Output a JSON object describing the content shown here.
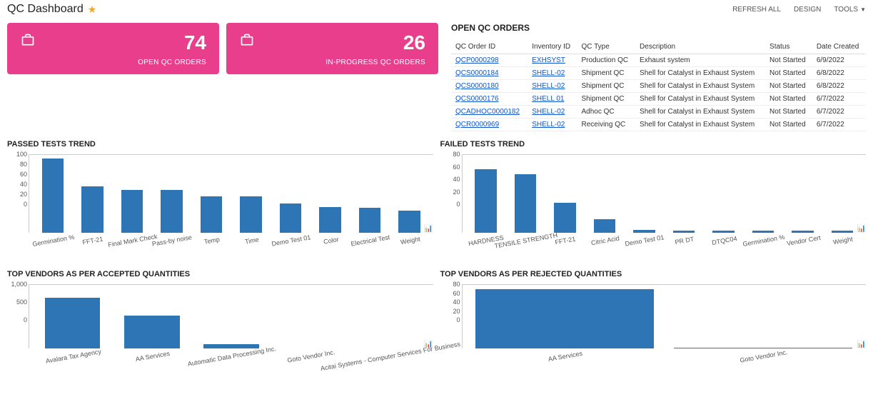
{
  "header": {
    "title": "QC Dashboard",
    "refresh_label": "REFRESH ALL",
    "design_label": "DESIGN",
    "tools_label": "TOOLS"
  },
  "kpis": [
    {
      "value": "74",
      "label": "OPEN QC ORDERS"
    },
    {
      "value": "26",
      "label": "IN-PROGRESS QC ORDERS"
    }
  ],
  "orders": {
    "title": "OPEN QC ORDERS",
    "columns": [
      "QC Order ID",
      "Inventory ID",
      "QC Type",
      "Description",
      "Status",
      "Date Created"
    ],
    "rows": [
      {
        "id": "QCP0000298",
        "inv": "EXHSYST",
        "type": "Production QC",
        "desc": "Exhaust system",
        "status": "Not Started",
        "date": "6/9/2022"
      },
      {
        "id": "QCS0000184",
        "inv": "SHELL-02",
        "type": "Shipment QC",
        "desc": "Shell for Catalyst in Exhaust System",
        "status": "Not Started",
        "date": "6/8/2022"
      },
      {
        "id": "QCS0000180",
        "inv": "SHELL-02",
        "type": "Shipment QC",
        "desc": "Shell for Catalyst in Exhaust System",
        "status": "Not Started",
        "date": "6/8/2022"
      },
      {
        "id": "QCS0000176",
        "inv": "SHELL 01",
        "type": "Shipment QC",
        "desc": "Shell for Catalyst in Exhaust System",
        "status": "Not Started",
        "date": "6/7/2022"
      },
      {
        "id": "QCADHOC0000182",
        "inv": "SHELL-02",
        "type": "Adhoc QC",
        "desc": "Shell for Catalyst in Exhaust System",
        "status": "Not Started",
        "date": "6/7/2022"
      },
      {
        "id": "QCR0000969",
        "inv": "SHELL-02",
        "type": "Receiving QC",
        "desc": "Shell for Catalyst in Exhaust System",
        "status": "Not Started",
        "date": "6/7/2022"
      }
    ]
  },
  "chart_data": [
    {
      "id": "passed",
      "type": "bar",
      "title": "PASSED TESTS TREND",
      "ylim": [
        0,
        100
      ],
      "yticks": [
        0,
        20,
        40,
        60,
        80,
        100
      ],
      "categories": [
        "Germination %",
        "FFT-21",
        "Final Mark Check",
        "Pass-by noise",
        "Temp",
        "Time",
        "Demo Test 01",
        "Color",
        "Electrical Test",
        "Weight"
      ],
      "values": [
        95,
        60,
        55,
        55,
        47,
        47,
        38,
        33,
        32,
        28
      ]
    },
    {
      "id": "failed",
      "type": "bar",
      "title": "FAILED TESTS TREND",
      "ylim": [
        0,
        80
      ],
      "yticks": [
        0,
        20,
        40,
        60,
        80
      ],
      "categories": [
        "HARDNESS",
        "TENSILE STRENGTH",
        "FFT-21",
        "Citric Acid",
        "Demo Test 01",
        "PR DT",
        "DTQC04",
        "Germination %",
        "Vendor Cert",
        "Weight"
      ],
      "values": [
        65,
        60,
        31,
        14,
        3,
        2,
        2,
        2,
        2,
        2
      ]
    },
    {
      "id": "accepted-vendors",
      "type": "bar",
      "title": "TOP VENDORS AS PER ACCEPTED QUANTITIES",
      "ylim": [
        0,
        1000
      ],
      "yticks": [
        0,
        500,
        1000
      ],
      "categories": [
        "Avalara Tax Agency",
        "AA Services",
        "Automatic Data Processing Inc.",
        "Goto Vendor Inc.",
        "Acitai Systems - Computer Services For Business"
      ],
      "values": [
        800,
        520,
        70,
        0,
        0
      ]
    },
    {
      "id": "rejected-vendors",
      "type": "bar",
      "title": "TOP VENDORS AS PER REJECTED QUANTITIES",
      "ylim": [
        0,
        80
      ],
      "yticks": [
        0,
        20,
        40,
        60,
        80
      ],
      "categories": [
        "AA Services",
        "Goto Vendor Inc."
      ],
      "values": [
        75,
        1
      ]
    }
  ]
}
